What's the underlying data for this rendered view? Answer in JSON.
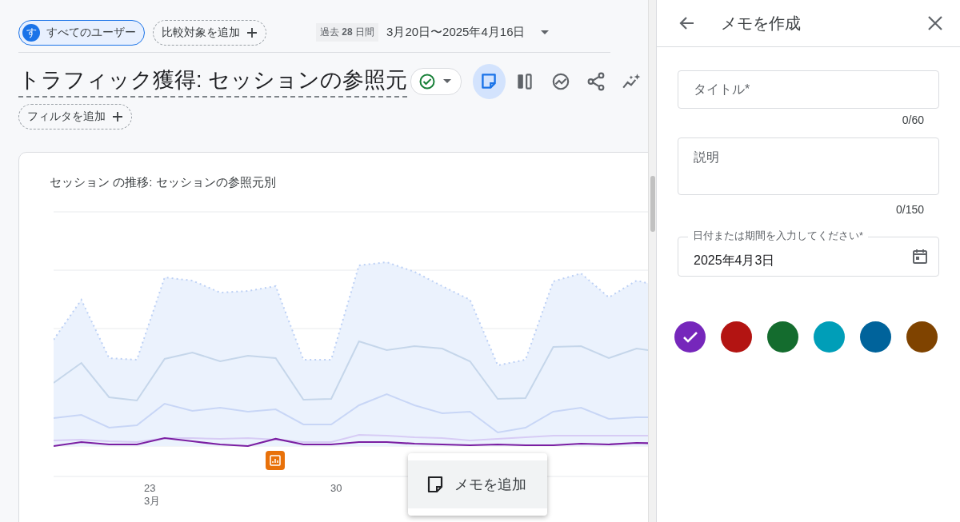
{
  "segment_chip": {
    "avatar": "す",
    "label": "すべてのユーザー"
  },
  "compare_chip": {
    "label": "比較対象を追加"
  },
  "date_range": {
    "period": "過去 **28** 日間",
    "range": "3月20日〜2025年4月16日"
  },
  "report": {
    "title": "トラフィック獲得: セッションの参照元",
    "toolbar": [
      {
        "kind": "note",
        "selected": true
      },
      {
        "kind": "columns",
        "selected": false
      },
      {
        "kind": "insights",
        "selected": false
      },
      {
        "kind": "share",
        "selected": false
      },
      {
        "kind": "sparkle",
        "selected": false
      }
    ]
  },
  "filter_chip": {
    "label": "フィルタを追加"
  },
  "chart_card": {
    "title": "セッション の推移: セッションの参照元別",
    "x_labels": [
      {
        "day": "23",
        "month": "3月"
      },
      {
        "day": "30"
      }
    ]
  },
  "context_menu": {
    "items": [
      {
        "label": "メモを追加"
      }
    ]
  },
  "note_panel": {
    "title": "メモを作成",
    "title_field": {
      "placeholder": "タイトル*",
      "counter": "0/60"
    },
    "description_field": {
      "placeholder": "説明",
      "counter": "0/150"
    },
    "date_field": {
      "label": "日付または期間を入力してください*",
      "value": "2025年4月3日"
    },
    "colors": [
      {
        "color": "#7627bb",
        "selected": true
      },
      {
        "color": "#b31412",
        "selected": false
      },
      {
        "color": "#146c2e",
        "selected": false
      },
      {
        "color": "#009eb8",
        "selected": false
      },
      {
        "color": "#00639b",
        "selected": false
      },
      {
        "color": "#7f4300",
        "selected": false
      }
    ]
  }
}
